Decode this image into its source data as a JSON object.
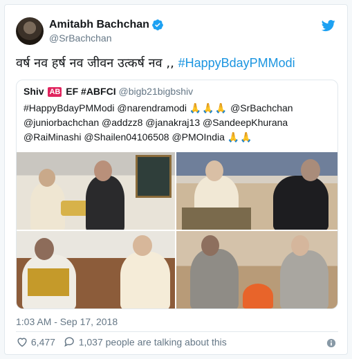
{
  "author": {
    "display_name": "Amitabh Bachchan",
    "handle": "@SrBachchan"
  },
  "tweet": {
    "text_hindi": "वर्ष नव हर्ष नव जीवन उत्कर्ष नव",
    "text_sep": " ,, ",
    "hashtag": "#HappyBdayPMModi",
    "timestamp": "1:03 AM - Sep 17, 2018"
  },
  "quoted_tweet": {
    "name_prefix": "Shiv",
    "badge": "AB",
    "name_suffix": "EF #ABFCI",
    "handle": "@bigb21bigbshiv",
    "line1_a": "#HappyBdayPMModi @narendramodi",
    "line1_b": "@SrBachchan",
    "line2": "@juniorbachchan @addzz8 @janakraj13 @SandeepKhurana",
    "line3_a": "@RaiMinashi @Shailen04106508 @PMOIndia",
    "pray_emoji": "🙏🙏🙏",
    "pray_emoji_2": "🙏🙏"
  },
  "engagement": {
    "likes": "6,477",
    "replies_text": "1,037 people are talking about this"
  },
  "colors": {
    "link": "#1b95e0",
    "secondary": "#657786",
    "border": "#e1e8ed"
  },
  "icons": {
    "verified": "verified-badge-icon",
    "twitter": "twitter-bird-icon",
    "heart": "heart-icon",
    "reply": "speech-bubble-icon",
    "info": "info-icon"
  }
}
